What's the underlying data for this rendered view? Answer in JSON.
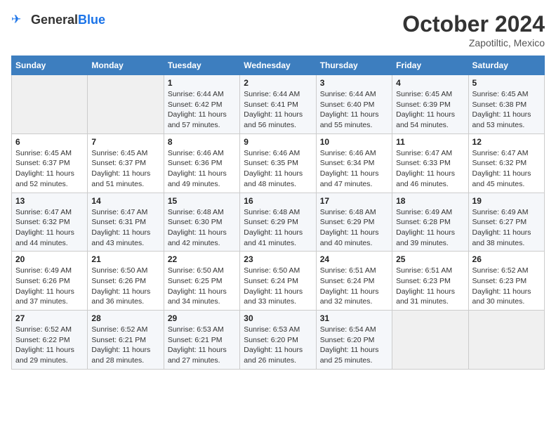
{
  "header": {
    "logo_general": "General",
    "logo_blue": "Blue",
    "month": "October 2024",
    "location": "Zapotiltic, Mexico"
  },
  "weekdays": [
    "Sunday",
    "Monday",
    "Tuesday",
    "Wednesday",
    "Thursday",
    "Friday",
    "Saturday"
  ],
  "weeks": [
    [
      {
        "day": "",
        "sunrise": "",
        "sunset": "",
        "daylight": ""
      },
      {
        "day": "",
        "sunrise": "",
        "sunset": "",
        "daylight": ""
      },
      {
        "day": "1",
        "sunrise": "Sunrise: 6:44 AM",
        "sunset": "Sunset: 6:42 PM",
        "daylight": "Daylight: 11 hours and 57 minutes."
      },
      {
        "day": "2",
        "sunrise": "Sunrise: 6:44 AM",
        "sunset": "Sunset: 6:41 PM",
        "daylight": "Daylight: 11 hours and 56 minutes."
      },
      {
        "day": "3",
        "sunrise": "Sunrise: 6:44 AM",
        "sunset": "Sunset: 6:40 PM",
        "daylight": "Daylight: 11 hours and 55 minutes."
      },
      {
        "day": "4",
        "sunrise": "Sunrise: 6:45 AM",
        "sunset": "Sunset: 6:39 PM",
        "daylight": "Daylight: 11 hours and 54 minutes."
      },
      {
        "day": "5",
        "sunrise": "Sunrise: 6:45 AM",
        "sunset": "Sunset: 6:38 PM",
        "daylight": "Daylight: 11 hours and 53 minutes."
      }
    ],
    [
      {
        "day": "6",
        "sunrise": "Sunrise: 6:45 AM",
        "sunset": "Sunset: 6:37 PM",
        "daylight": "Daylight: 11 hours and 52 minutes."
      },
      {
        "day": "7",
        "sunrise": "Sunrise: 6:45 AM",
        "sunset": "Sunset: 6:37 PM",
        "daylight": "Daylight: 11 hours and 51 minutes."
      },
      {
        "day": "8",
        "sunrise": "Sunrise: 6:46 AM",
        "sunset": "Sunset: 6:36 PM",
        "daylight": "Daylight: 11 hours and 49 minutes."
      },
      {
        "day": "9",
        "sunrise": "Sunrise: 6:46 AM",
        "sunset": "Sunset: 6:35 PM",
        "daylight": "Daylight: 11 hours and 48 minutes."
      },
      {
        "day": "10",
        "sunrise": "Sunrise: 6:46 AM",
        "sunset": "Sunset: 6:34 PM",
        "daylight": "Daylight: 11 hours and 47 minutes."
      },
      {
        "day": "11",
        "sunrise": "Sunrise: 6:47 AM",
        "sunset": "Sunset: 6:33 PM",
        "daylight": "Daylight: 11 hours and 46 minutes."
      },
      {
        "day": "12",
        "sunrise": "Sunrise: 6:47 AM",
        "sunset": "Sunset: 6:32 PM",
        "daylight": "Daylight: 11 hours and 45 minutes."
      }
    ],
    [
      {
        "day": "13",
        "sunrise": "Sunrise: 6:47 AM",
        "sunset": "Sunset: 6:32 PM",
        "daylight": "Daylight: 11 hours and 44 minutes."
      },
      {
        "day": "14",
        "sunrise": "Sunrise: 6:47 AM",
        "sunset": "Sunset: 6:31 PM",
        "daylight": "Daylight: 11 hours and 43 minutes."
      },
      {
        "day": "15",
        "sunrise": "Sunrise: 6:48 AM",
        "sunset": "Sunset: 6:30 PM",
        "daylight": "Daylight: 11 hours and 42 minutes."
      },
      {
        "day": "16",
        "sunrise": "Sunrise: 6:48 AM",
        "sunset": "Sunset: 6:29 PM",
        "daylight": "Daylight: 11 hours and 41 minutes."
      },
      {
        "day": "17",
        "sunrise": "Sunrise: 6:48 AM",
        "sunset": "Sunset: 6:29 PM",
        "daylight": "Daylight: 11 hours and 40 minutes."
      },
      {
        "day": "18",
        "sunrise": "Sunrise: 6:49 AM",
        "sunset": "Sunset: 6:28 PM",
        "daylight": "Daylight: 11 hours and 39 minutes."
      },
      {
        "day": "19",
        "sunrise": "Sunrise: 6:49 AM",
        "sunset": "Sunset: 6:27 PM",
        "daylight": "Daylight: 11 hours and 38 minutes."
      }
    ],
    [
      {
        "day": "20",
        "sunrise": "Sunrise: 6:49 AM",
        "sunset": "Sunset: 6:26 PM",
        "daylight": "Daylight: 11 hours and 37 minutes."
      },
      {
        "day": "21",
        "sunrise": "Sunrise: 6:50 AM",
        "sunset": "Sunset: 6:26 PM",
        "daylight": "Daylight: 11 hours and 36 minutes."
      },
      {
        "day": "22",
        "sunrise": "Sunrise: 6:50 AM",
        "sunset": "Sunset: 6:25 PM",
        "daylight": "Daylight: 11 hours and 34 minutes."
      },
      {
        "day": "23",
        "sunrise": "Sunrise: 6:50 AM",
        "sunset": "Sunset: 6:24 PM",
        "daylight": "Daylight: 11 hours and 33 minutes."
      },
      {
        "day": "24",
        "sunrise": "Sunrise: 6:51 AM",
        "sunset": "Sunset: 6:24 PM",
        "daylight": "Daylight: 11 hours and 32 minutes."
      },
      {
        "day": "25",
        "sunrise": "Sunrise: 6:51 AM",
        "sunset": "Sunset: 6:23 PM",
        "daylight": "Daylight: 11 hours and 31 minutes."
      },
      {
        "day": "26",
        "sunrise": "Sunrise: 6:52 AM",
        "sunset": "Sunset: 6:23 PM",
        "daylight": "Daylight: 11 hours and 30 minutes."
      }
    ],
    [
      {
        "day": "27",
        "sunrise": "Sunrise: 6:52 AM",
        "sunset": "Sunset: 6:22 PM",
        "daylight": "Daylight: 11 hours and 29 minutes."
      },
      {
        "day": "28",
        "sunrise": "Sunrise: 6:52 AM",
        "sunset": "Sunset: 6:21 PM",
        "daylight": "Daylight: 11 hours and 28 minutes."
      },
      {
        "day": "29",
        "sunrise": "Sunrise: 6:53 AM",
        "sunset": "Sunset: 6:21 PM",
        "daylight": "Daylight: 11 hours and 27 minutes."
      },
      {
        "day": "30",
        "sunrise": "Sunrise: 6:53 AM",
        "sunset": "Sunset: 6:20 PM",
        "daylight": "Daylight: 11 hours and 26 minutes."
      },
      {
        "day": "31",
        "sunrise": "Sunrise: 6:54 AM",
        "sunset": "Sunset: 6:20 PM",
        "daylight": "Daylight: 11 hours and 25 minutes."
      },
      {
        "day": "",
        "sunrise": "",
        "sunset": "",
        "daylight": ""
      },
      {
        "day": "",
        "sunrise": "",
        "sunset": "",
        "daylight": ""
      }
    ]
  ]
}
